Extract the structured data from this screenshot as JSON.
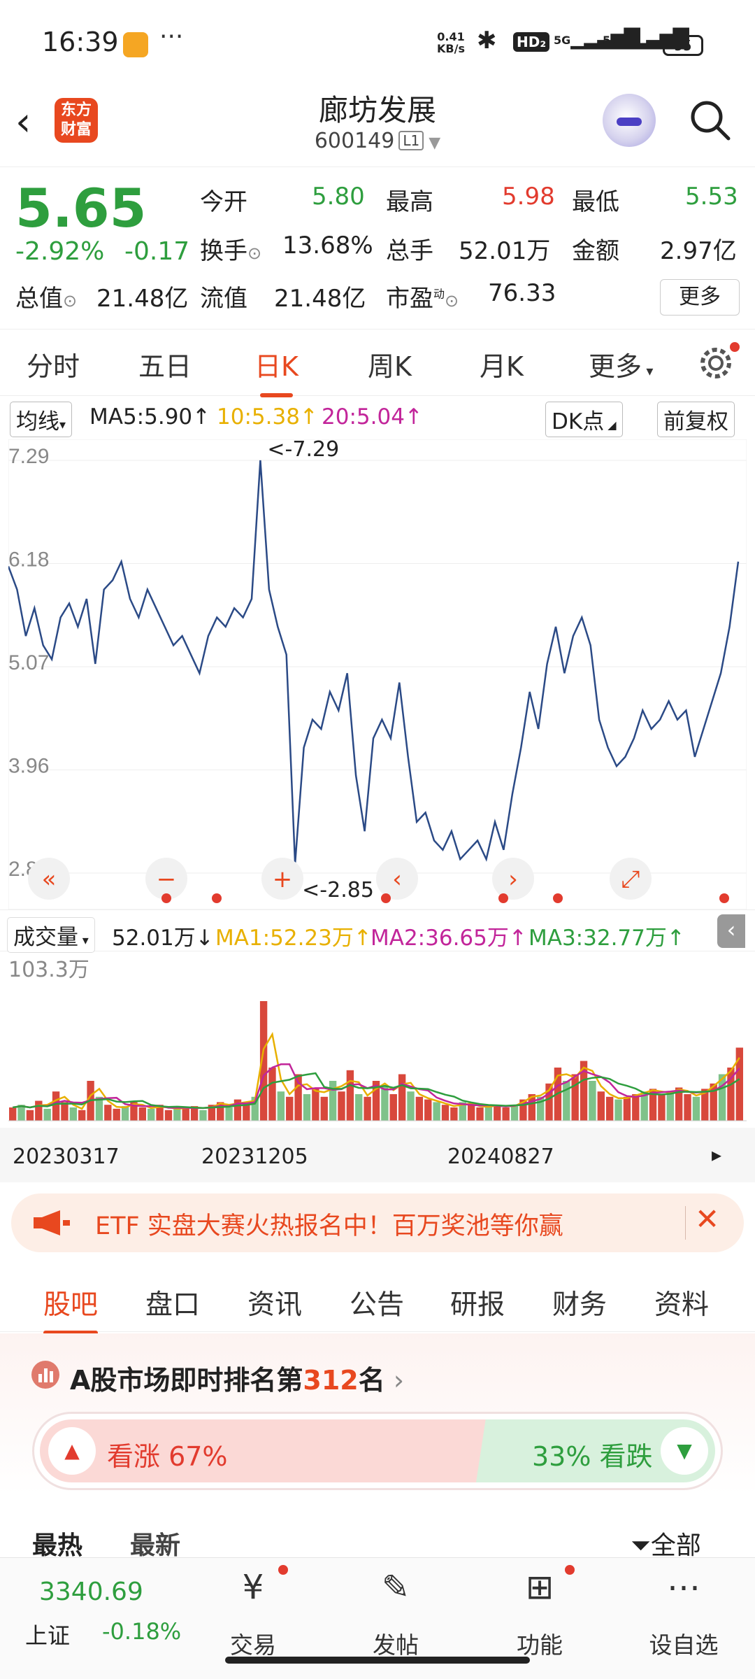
{
  "status_bar": {
    "time": "16:39",
    "more": "···",
    "net_speed": "0.41",
    "net_unit": "KB/s",
    "hd": "HD₂",
    "sig1": "5G",
    "sig2": "5G",
    "battery": "55"
  },
  "header": {
    "title": "廊坊发展",
    "code": "600149",
    "level": "L1",
    "logo": "东方 财富"
  },
  "quote": {
    "price": "5.65",
    "change_pct": "-2.92%",
    "change": "-0.17",
    "open_label": "今开",
    "open": "5.80",
    "high_label": "最高",
    "high": "5.98",
    "low_label": "最低",
    "low": "5.53",
    "turnover_label": "换手",
    "turnover": "13.68%",
    "vol_label": "总手",
    "vol": "52.01万",
    "amount_label": "金额",
    "amount": "2.97亿",
    "mcap_label": "总值",
    "mcap": "21.48亿",
    "float_label": "流值",
    "float": "21.48亿",
    "pe_label": "市盈",
    "pe_sup": "动",
    "pe": "76.33",
    "more": "更多"
  },
  "period_tabs": [
    "分时",
    "五日",
    "日K",
    "周K",
    "月K",
    "更多"
  ],
  "ma_row": {
    "type": "均线",
    "ma5": "MA5:5.90",
    "ma10": "10:5.38",
    "ma20": "20:5.04",
    "dk": "DK点",
    "fq": "前复权"
  },
  "chart_data": {
    "type": "line",
    "title": "",
    "y_ticks": [
      "7.29",
      "6.18",
      "5.07",
      "3.96",
      "2.85"
    ],
    "ylim": [
      2.85,
      7.29
    ],
    "max_label": "<-7.29",
    "min_label": "<-2.85",
    "x_ticks": [
      "20230317",
      "20231205",
      "20240827"
    ],
    "values": [
      6.15,
      5.9,
      5.4,
      5.7,
      5.3,
      5.15,
      5.6,
      5.75,
      5.5,
      5.8,
      5.1,
      5.9,
      6.0,
      6.2,
      5.8,
      5.6,
      5.9,
      5.7,
      5.5,
      5.3,
      5.4,
      5.2,
      5.0,
      5.4,
      5.6,
      5.5,
      5.7,
      5.6,
      5.8,
      7.29,
      5.9,
      5.5,
      5.2,
      2.95,
      4.2,
      4.5,
      4.4,
      4.8,
      4.6,
      5.0,
      3.9,
      3.3,
      4.3,
      4.5,
      4.3,
      4.9,
      4.1,
      3.4,
      3.5,
      3.2,
      3.1,
      3.3,
      3.0,
      3.1,
      3.2,
      3.0,
      3.4,
      3.1,
      3.7,
      4.2,
      4.8,
      4.4,
      5.1,
      5.5,
      5.0,
      5.4,
      5.6,
      5.3,
      4.5,
      4.2,
      4.0,
      4.1,
      4.3,
      4.6,
      4.4,
      4.5,
      4.7,
      4.5,
      4.6,
      4.1,
      4.4,
      4.7,
      5.0,
      5.5,
      6.2
    ],
    "volume": {
      "title": "成交量",
      "value": "52.01万",
      "ma1": "MA1:52.23万",
      "ma2": "MA2:36.65万",
      "ma3": "MA3:32.77万",
      "max": "103.3万",
      "bars": [
        10,
        12,
        8,
        15,
        9,
        22,
        14,
        10,
        8,
        30,
        18,
        12,
        9,
        11,
        14,
        10,
        9,
        12,
        8,
        10,
        9,
        11,
        8,
        12,
        14,
        10,
        16,
        12,
        18,
        90,
        40,
        22,
        18,
        35,
        20,
        25,
        18,
        30,
        22,
        38,
        20,
        18,
        30,
        26,
        20,
        35,
        22,
        18,
        16,
        14,
        12,
        10,
        14,
        12,
        10,
        11,
        12,
        10,
        12,
        16,
        20,
        18,
        28,
        40,
        30,
        35,
        45,
        30,
        22,
        18,
        16,
        18,
        20,
        22,
        24,
        20,
        22,
        25,
        20,
        18,
        24,
        28,
        35,
        40,
        55
      ]
    }
  },
  "banner": {
    "text": "ETF 实盘大赛火热报名中！百万奖池等你赢"
  },
  "news_tabs": [
    "股吧",
    "盘口",
    "资讯",
    "公告",
    "研报",
    "财务",
    "资料"
  ],
  "rank": {
    "prefix": "A股市场即时排名第",
    "num": "312",
    "suffix": "名"
  },
  "sentiment": {
    "up_label": "看涨 67%",
    "down_label": "33% 看跌"
  },
  "sort": {
    "hot": "最热",
    "new": "最新",
    "filter": "全部"
  },
  "bottom_nav": {
    "index_value": "3340.69",
    "index_name": "上证",
    "index_change": "-0.18%",
    "trade": "交易",
    "post": "发帖",
    "func": "功能",
    "watch": "设自选"
  },
  "colors": {
    "up": "#e23b2e",
    "down": "#2e9e3e",
    "accent": "#e8481f",
    "line": "#2b4a86"
  }
}
